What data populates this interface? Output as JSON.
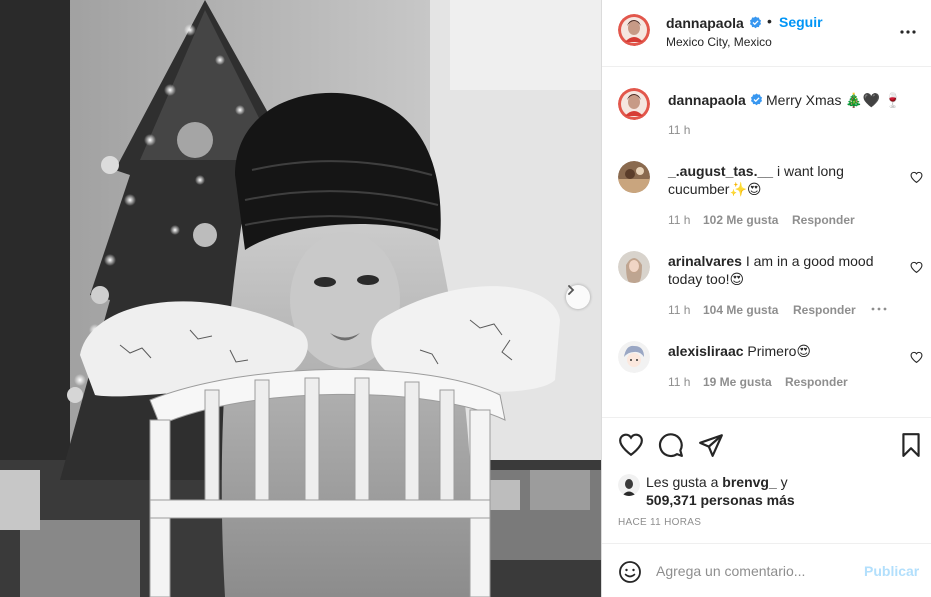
{
  "post": {
    "author": "dannapaola",
    "follow_label": "Seguir",
    "dot": "•",
    "location": "Mexico City, Mexico",
    "more_icon": "more-horizontal-icon",
    "verified_icon": "verified-badge-icon"
  },
  "caption": {
    "author": "dannapaola",
    "text": "Merry Xmas 🎄🖤 🍷",
    "time": "11 h"
  },
  "comments": [
    {
      "author": "_.august_tas.__",
      "text": "i want long cucumber✨😍",
      "time": "11 h",
      "likes": "102 Me gusta",
      "reply": "Responder"
    },
    {
      "author": "arinalvares",
      "text": "I am in a good mood today too!😍",
      "time": "11 h",
      "likes": "104 Me gusta",
      "reply": "Responder"
    },
    {
      "author": "alexisliraac",
      "text": "Primero😍",
      "time": "11 h",
      "likes": "19 Me gusta",
      "reply": "Responder"
    }
  ],
  "likes": {
    "prefix": "Les gusta a",
    "user": "brenvg_",
    "joiner": "y",
    "count": "509,371 personas más"
  },
  "time_ago": "HACE 11 HORAS",
  "add_comment": {
    "placeholder": "Agrega un comentario...",
    "publish_label": "Publicar"
  },
  "colors": {
    "link_blue": "#0095f6",
    "publish_disabled": "#b2dffc",
    "muted": "#8e8e8e",
    "text": "#262626",
    "border": "#dbdbdb"
  }
}
